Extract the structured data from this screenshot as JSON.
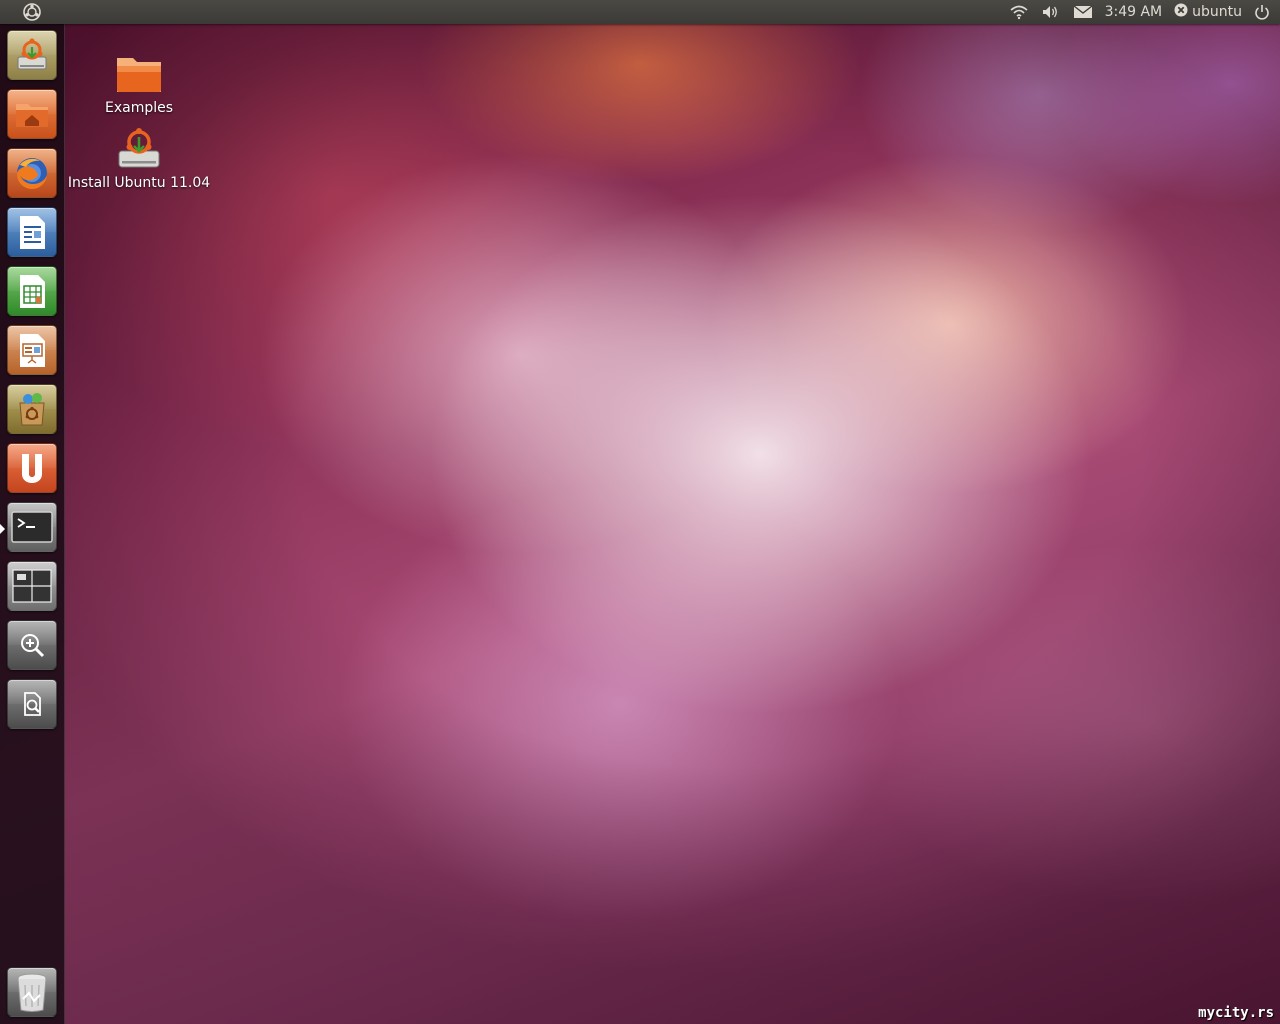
{
  "top_panel": {
    "menu_icon": "ubuntu-logo-icon",
    "tray": {
      "network_icon": "wifi-icon",
      "sound_icon": "volume-icon",
      "mail_icon": "envelope-icon",
      "clock": "3:49 AM",
      "user_icon": "user-status-icon",
      "user_name": "ubuntu",
      "power_icon": "power-icon"
    }
  },
  "launcher": {
    "items": [
      {
        "icon": "install-ubuntu-icon"
      },
      {
        "icon": "home-folder-icon"
      },
      {
        "icon": "firefox-icon"
      },
      {
        "icon": "libreoffice-writer-icon"
      },
      {
        "icon": "libreoffice-calc-icon"
      },
      {
        "icon": "libreoffice-impress-icon"
      },
      {
        "icon": "software-center-icon"
      },
      {
        "icon": "ubuntu-one-icon"
      },
      {
        "icon": "terminal-icon",
        "running": true
      },
      {
        "icon": "workspace-switcher-icon"
      },
      {
        "icon": "applications-lens-icon"
      },
      {
        "icon": "files-lens-icon"
      },
      {
        "icon": "trash-icon"
      }
    ]
  },
  "desktop": {
    "icons": [
      {
        "label": "Examples",
        "icon": "folder-icon"
      },
      {
        "label": "Install Ubuntu 11.04",
        "icon": "install-ubuntu-icon"
      }
    ]
  },
  "watermark": "mycity.rs",
  "colors": {
    "panel": "#3b3a36",
    "panel_text": "#dfdbd2",
    "accent_orange": "#dd4814"
  }
}
